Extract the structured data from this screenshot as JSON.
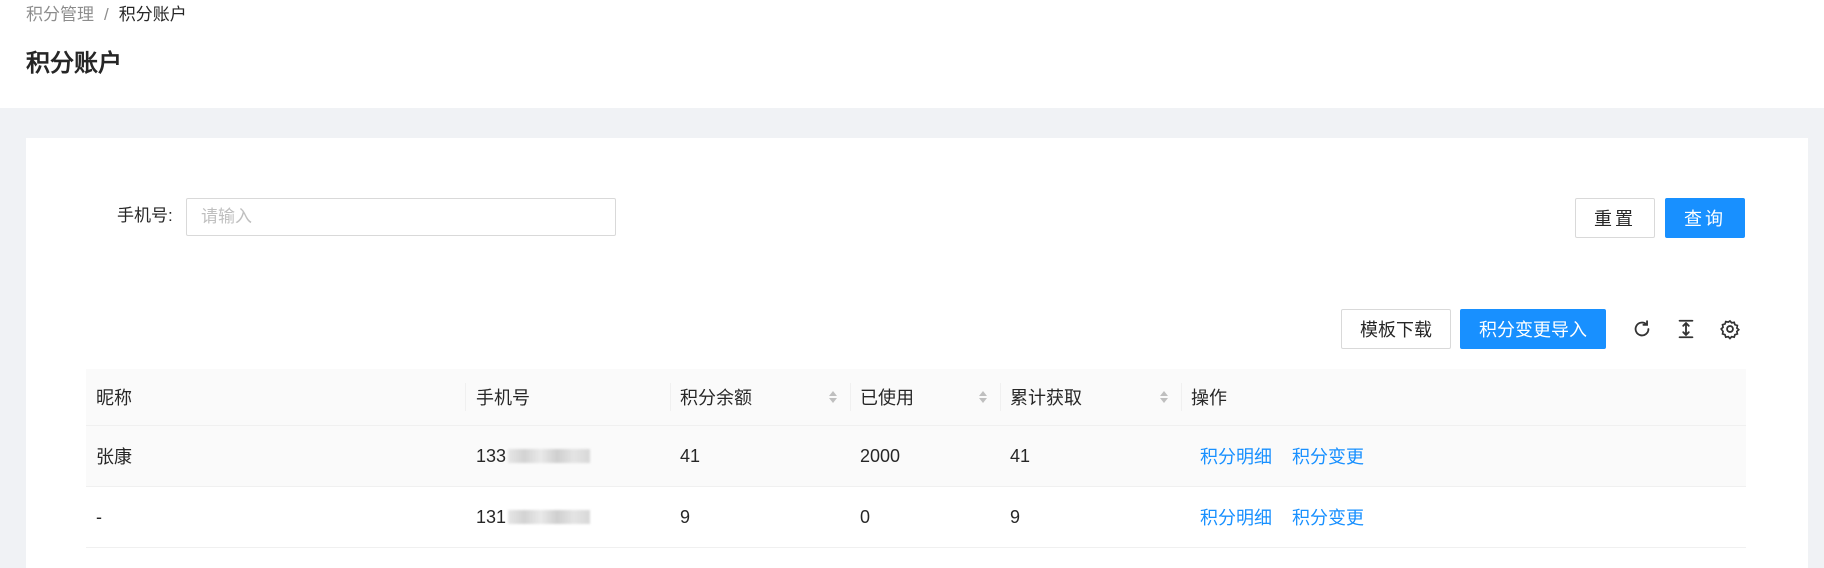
{
  "breadcrumb": {
    "parent": "积分管理",
    "separator": "/",
    "current": "积分账户"
  },
  "page_title": "积分账户",
  "search": {
    "label": "手机号:",
    "placeholder": "请输入",
    "value": ""
  },
  "buttons": {
    "reset": "重置",
    "query": "查询",
    "template_download": "模板下载",
    "import": "积分变更导入"
  },
  "toolbar_icons": [
    "reload-icon",
    "column-height-icon",
    "setting-icon"
  ],
  "table": {
    "columns": [
      "昵称",
      "手机号",
      "积分余额",
      "已使用",
      "累计获取",
      "操作"
    ],
    "sortable_columns": [
      "积分余额",
      "已使用",
      "累计获取"
    ],
    "rows": [
      {
        "nickname": "张康",
        "phone": "133",
        "balance": "41",
        "used": "2000",
        "total": "41",
        "action_detail": "积分明细",
        "action_change": "积分变更"
      },
      {
        "nickname": "-",
        "phone": "131",
        "balance": "9",
        "used": "0",
        "total": "9",
        "action_detail": "积分明细",
        "action_change": "积分变更"
      }
    ]
  },
  "colors": {
    "primary": "#1890ff",
    "background": "#f0f2f5"
  }
}
